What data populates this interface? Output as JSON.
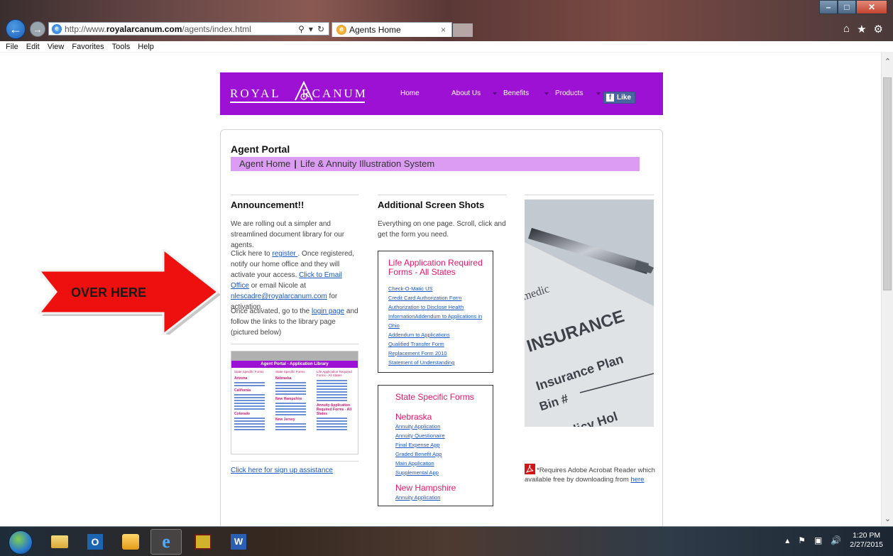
{
  "browser": {
    "url_prefix": "http://www.",
    "url_domain": "royalarcanum.com",
    "url_path": "/agents/index.html",
    "tab_title": "Agents Home",
    "search_icon": "search-icon",
    "refresh_icon": "refresh-icon",
    "tab_close": "×",
    "menu": [
      "File",
      "Edit",
      "View",
      "Favorites",
      "Tools",
      "Help"
    ]
  },
  "site": {
    "logo_left": "ROYAL ",
    "logo_right": "RCANUM",
    "nav": [
      "Home",
      "About Us",
      "Benefits",
      "Products"
    ],
    "fb_like": "Like",
    "brand_color": "#9c11d3"
  },
  "portal": {
    "title": "Agent Portal",
    "tab1": "Agent Home",
    "tab_sep": "|",
    "tab2": "Life & Annuity Illustration System"
  },
  "announcement": {
    "heading": "Announcement!!",
    "intro": "We are rolling out a simpler and streamlined document library for our agents.",
    "p2_a": "Click here to ",
    "register_link": "register ",
    "p2_b": ". Once registered, notify our home office and they will activate your access. ",
    "email_office_link": "Click to Email Office",
    "p2_c": " or email Nicole at ",
    "email_link": "nlescadre@royalarcanum.com",
    "p2_d": " for activation.",
    "p3_a": "Once activated, go to the ",
    "login_link": "login page",
    "p3_b": " and follow the links to the library page (pictured below)",
    "signup_link": "Click here for sign up assistance",
    "thumb_title": "Agent Portal - Application Library",
    "thumb_cols": [
      "State Specific Forms",
      "State Specific Forms",
      "Life Application Required Forms - All States"
    ],
    "thumb_states": [
      "Arizona",
      "California",
      "Colorado",
      "Nebraska",
      "New Hampshire",
      "New Jersey",
      "Annuity Application Required Forms - All States"
    ]
  },
  "screenshots": {
    "heading": "Additional Screen Shots",
    "intro": "Everything on one page. Scroll, click and get the form you need.",
    "life_box": {
      "title": "Life Application Required Forms - All States",
      "links": [
        "Check-O-Matic US",
        "Credit Card Authorization Form",
        "Authorization to Disclose Health",
        "InformationAddendum to Applications in",
        "Ohio",
        "Addendum to Applications",
        "Qualified Transfer Form",
        "Replacement Form 2010",
        "Statement of Understanding"
      ]
    },
    "state_box": {
      "title": "State Specific Forms",
      "state1": "Nebraska",
      "state1_links": [
        "Annuity Application",
        "Annuity Questionaire",
        "Final Expense App",
        "Graded Benefit App",
        "Main Application",
        "Supplemental App"
      ],
      "state2": "New Hampshire",
      "state2_links": [
        "Annuity Application"
      ]
    }
  },
  "photo": {
    "words": [
      "medic",
      "INSURANCE",
      "Insurance Plan",
      "Bin #",
      "Policy Hol"
    ]
  },
  "pdf_note": {
    "text": "*Requires Adobe Acrobat Reader which available free by downloading from ",
    "link": "here"
  },
  "arrow": {
    "label": "OVER HERE"
  },
  "taskbar": {
    "time": "1:20 PM",
    "date": "2/27/2015"
  }
}
